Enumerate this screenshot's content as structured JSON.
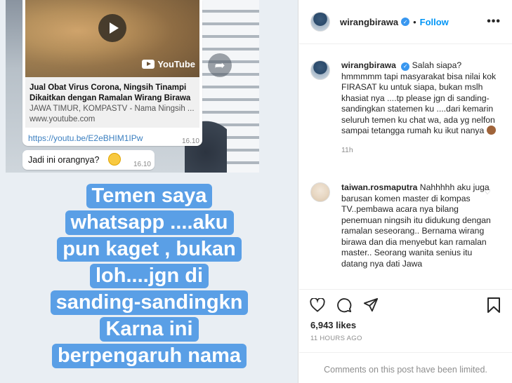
{
  "post": {
    "media": {
      "whatsapp": {
        "link_title": "Jual Obat Virus Corona, Ningsih Tinampi Dikaitkan dengan Ramalan Wirang Birawa",
        "link_desc": "JAWA TIMUR, KOMPASTV - Nama Ningsih ...",
        "link_domain": "www.youtube.com",
        "link_url": "https://youtu.be/E2eBHIM1IPw",
        "time1": "16.10",
        "message2": "Jadi ini orangnya?",
        "time2": "16.10",
        "youtube_label": "YouTube"
      },
      "caption_lines": [
        "Temen saya",
        "whatsapp ....aku",
        "pun kaget , bukan",
        "loh....jgn di",
        "sanding-sandingkn",
        "Karna ini",
        "berpengaruh nama"
      ]
    },
    "header": {
      "username": "wirangbirawa",
      "dot": "•",
      "follow_label": "Follow",
      "more_icon": "more-horizontal-icon"
    },
    "caption_comment": {
      "username": "wirangbirawa",
      "text": "Salah siapa? hmmmmm tapi masyarakat bisa nilai kok FIRASAT ku untuk siapa, bukan mslh khasiat nya ....tp please jgn di sanding-sandingkan statemen ku ....dari kemarin seluruh temen ku chat wa, ada yg nelfon sampai tetangga rumah ku ikut nanya",
      "time": "11h"
    },
    "comment1": {
      "username": "taiwan.rosmaputra",
      "text": "Nahhhhh aku juga barusan komen master di kompas TV..pembawa acara nya bilang penemuan ningsih itu didukung dengan ramalan seseorang.. Bernama wirang birawa dan dia menyebut kan ramalan master.. Seorang wanita senius itu datang nya dati Jawa"
    },
    "likes": "6,943 likes",
    "time_ago": "11 HOURS AGO",
    "limited_text": "Comments on this post have been limited.",
    "colors": {
      "accent": "#0095f6",
      "verified": "#3897f0",
      "caption_bg": "#5a9fe6",
      "link_blue": "#3b7fc0"
    }
  }
}
